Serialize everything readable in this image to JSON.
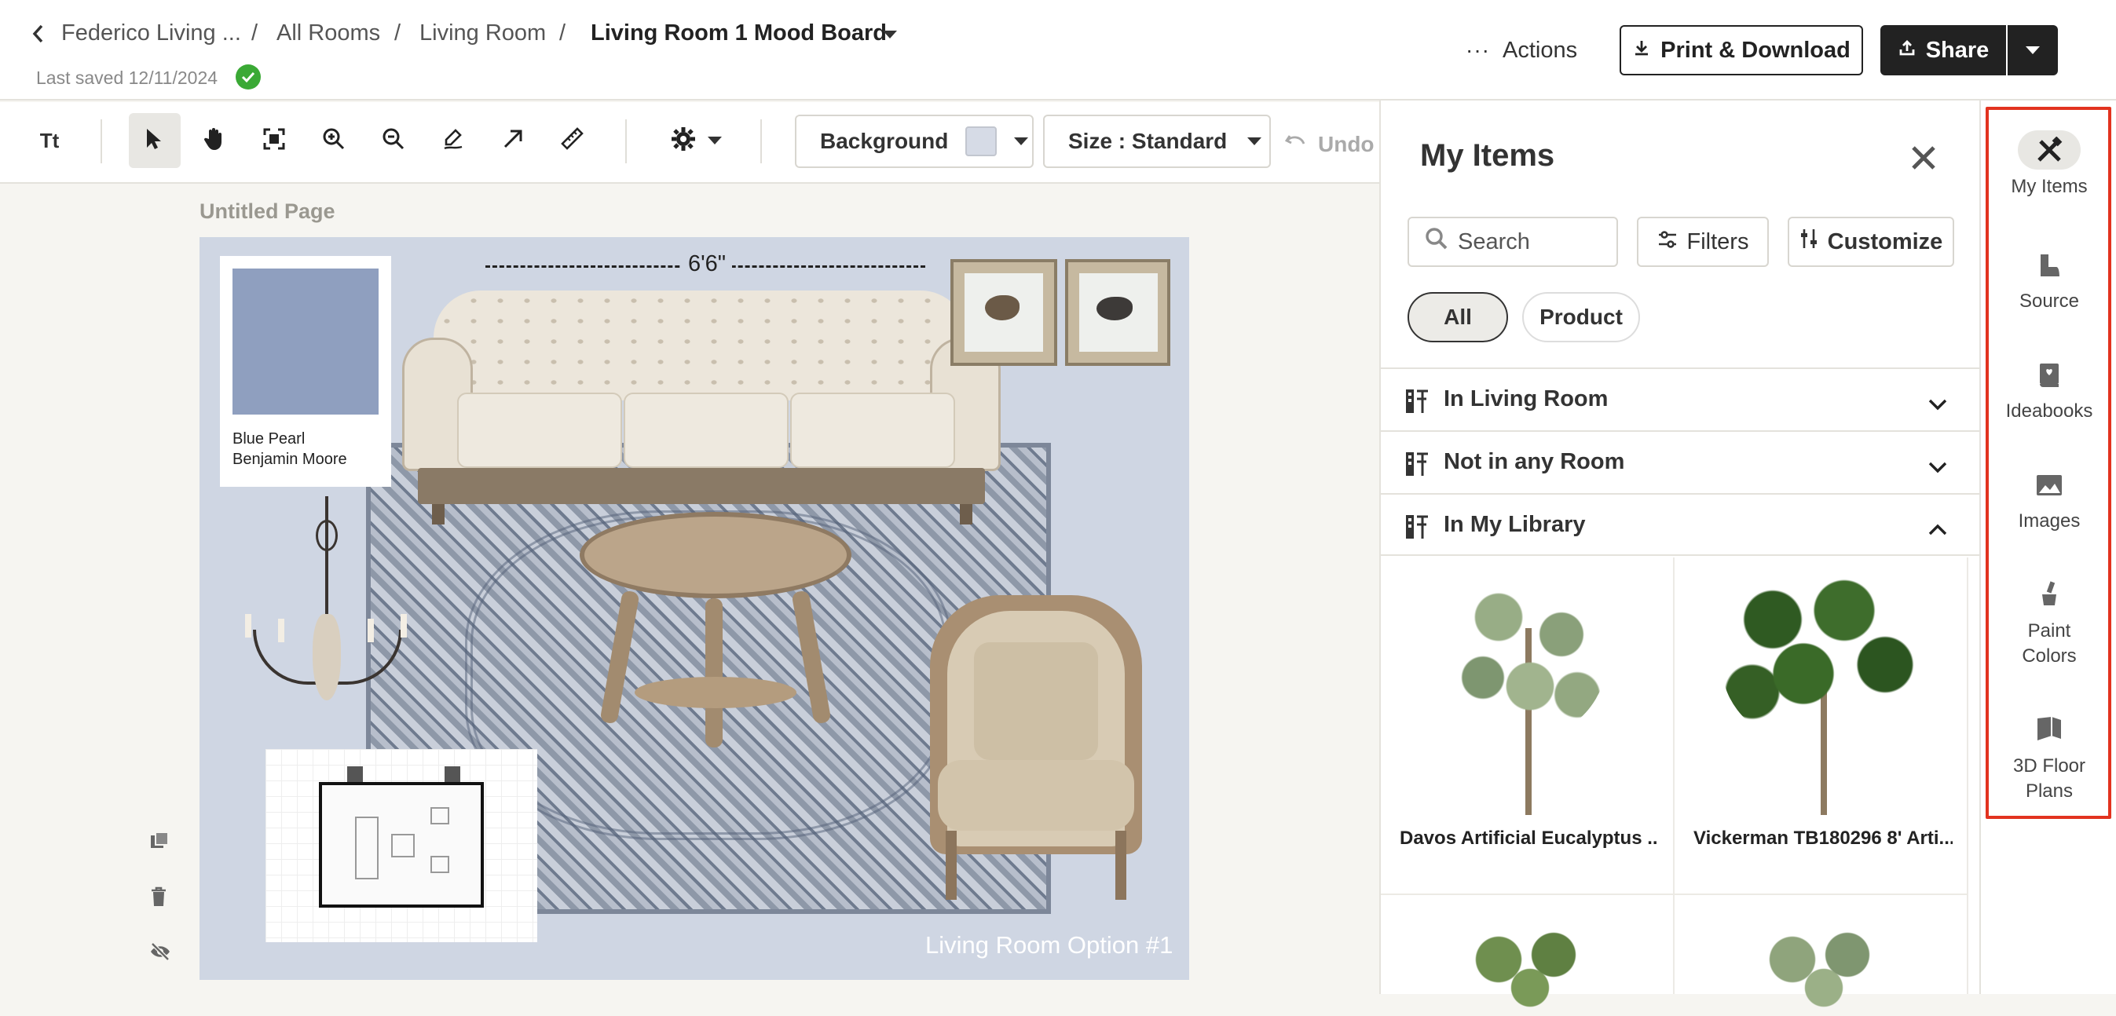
{
  "header": {
    "back_label": "Federico Living ...",
    "breadcrumb": [
      "All Rooms",
      "Living Room"
    ],
    "separator": "/",
    "current": "Living Room 1 Mood Board",
    "last_saved": "Last saved 12/11/2024",
    "actions_label": "Actions",
    "print_label": "Print & Download",
    "share_label": "Share"
  },
  "toolbar": {
    "text_tool": "Tt",
    "background_label": "Background",
    "background_swatch": "#d6dbe6",
    "size_label": "Size : Standard",
    "undo_label": "Undo"
  },
  "canvas": {
    "page_title": "Untitled Page",
    "dimension_label": "6'6\"",
    "paint_swatch_color": "#8f9fbf",
    "paint_name": "Blue Pearl",
    "paint_brand": "Benjamin Moore",
    "board_caption": "Living Room Option #1"
  },
  "panel": {
    "title": "My Items",
    "search_placeholder": "Search",
    "filters_label": "Filters",
    "customize_label": "Customize",
    "chips": [
      "All",
      "Product"
    ],
    "sections": [
      "In Living Room",
      "Not in any Room",
      "In My Library"
    ],
    "products": [
      {
        "name": "Davos Artificial Eucalyptus ..."
      },
      {
        "name": "Vickerman TB180296 8' Arti..."
      }
    ]
  },
  "rail": {
    "items": [
      {
        "label": "My Items",
        "icon": "design-tools-icon"
      },
      {
        "label": "Source",
        "icon": "boot-icon"
      },
      {
        "label": "Ideabooks",
        "icon": "ideabook-icon"
      },
      {
        "label": "Images",
        "icon": "image-icon"
      },
      {
        "label": "Paint Colors",
        "icon": "paint-brush-icon"
      },
      {
        "label": "3D Floor Plans",
        "icon": "floor-plan-icon"
      }
    ]
  }
}
